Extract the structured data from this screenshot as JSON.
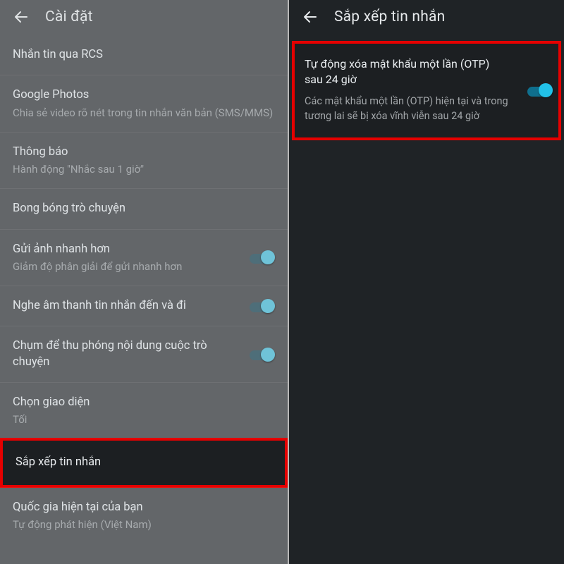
{
  "left": {
    "title": "Cài đặt",
    "rows": [
      {
        "primary": "Nhắn tin qua RCS"
      },
      {
        "primary": "Google Photos",
        "secondary": "Chia sẻ video rõ nét trong tin nhắn văn bản (SMS/MMS)"
      },
      {
        "primary": "Thông báo",
        "secondary": "Hành động \"Nhắc sau 1 giờ\""
      },
      {
        "primary": "Bong bóng trò chuyện"
      },
      {
        "primary": "Gửi ảnh nhanh hơn",
        "secondary": "Giảm độ phân giải để gửi nhanh hơn",
        "toggle": true
      },
      {
        "primary": "Nghe âm thanh tin nhắn đến và đi",
        "toggle": true
      },
      {
        "primary": "Chụm để thu phóng nội dung cuộc trò chuyện",
        "toggle": true
      },
      {
        "primary": "Chọn giao diện",
        "secondary": "Tối"
      },
      {
        "primary": "Sắp xếp tin nhắn",
        "highlight": true
      },
      {
        "primary": "Quốc gia hiện tại của bạn",
        "secondary": "Tự động phát hiện (Việt Nam)"
      }
    ]
  },
  "right": {
    "title": "Sắp xếp tin nhắn",
    "card": {
      "primary": "Tự động xóa mật khẩu một lần (OTP) sau 24 giờ",
      "secondary": "Các mật khẩu một lần (OTP) hiện tại và trong tương lai sẽ bị xóa vĩnh viễn sau 24 giờ",
      "toggle": true
    }
  }
}
